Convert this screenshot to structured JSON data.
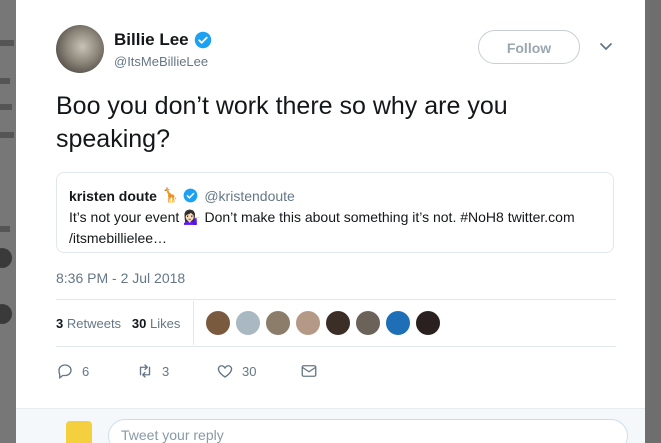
{
  "tweet": {
    "author_name": "Billie Lee",
    "author_handle": "@ItsMeBillieLee",
    "follow_label": "Follow",
    "text": "Boo you don’t work there so why are you speaking?",
    "timestamp": "8:36 PM - 2 Jul 2018"
  },
  "quote": {
    "name": "kristen doute",
    "emoji": "🦒",
    "handle": "@kristendoute",
    "text": "It’s not your event 💁🏻‍♀️ Don’t make this about something it’s not. #NoH8 twitter.com /itsmebillielee…"
  },
  "stats": {
    "retweets_count": "3",
    "retweets_label": "Retweets",
    "likes_count": "30",
    "likes_label": "Likes"
  },
  "actions": {
    "reply_count": "6",
    "retweet_count": "3",
    "like_count": "30"
  },
  "reply": {
    "placeholder": "Tweet your reply"
  },
  "icons": [
    "verified-icon",
    "chevron-down-icon",
    "reply-icon",
    "retweet-icon",
    "like-icon",
    "dm-icon"
  ],
  "colors": {
    "verified": "#1da1f2",
    "text": "#14171a",
    "secondary": "#657786",
    "border": "#e1e8ed"
  }
}
